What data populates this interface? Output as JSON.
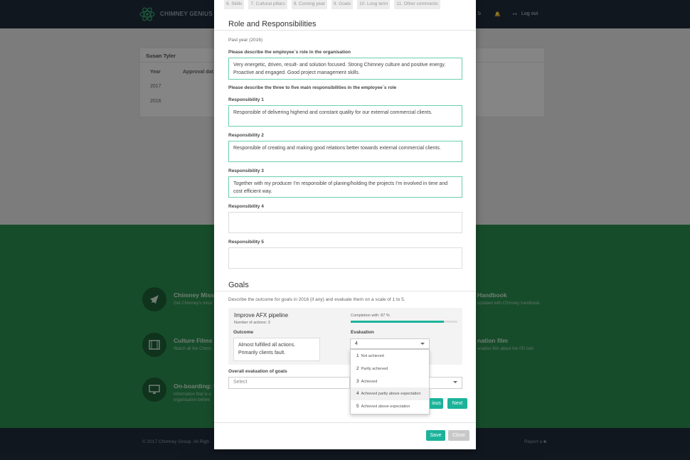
{
  "header": {
    "brand": "CHIMNEY GENIUS HU",
    "tab_fragment": "b",
    "logout": "Log out"
  },
  "card": {
    "employee": "Susan Tyler",
    "col_year": "Year",
    "col_approval": "Approval dat",
    "years": [
      "2017",
      "2016"
    ]
  },
  "features_left": [
    {
      "title": "Chimney Missi",
      "text": "Get Chimney's missi"
    },
    {
      "title": "Culture Films",
      "text": "Watch all the Chimn"
    },
    {
      "title": "On-boarding: t",
      "text": "Information that is u",
      "text2": "organisation before"
    }
  ],
  "features_right": [
    {
      "title": "Handbook",
      "text": "updated with Chimney handbook."
    },
    {
      "title": "nation film",
      "text": "anation film about the PD tool"
    }
  ],
  "footer": {
    "copyright": "© 2017 Chimney Group. All Righ",
    "report": "Report a"
  },
  "modal": {
    "steps": [
      "6. Skills",
      "7. Cultural pillars",
      "8. Coming year",
      "9. Goals",
      "10. Long term",
      "11. Other comments"
    ],
    "role_title": "Role and Responsibilities",
    "past_year": "Past year (2016)",
    "role_label": "Please describe the employee´s role in the organisation",
    "role_text": "Very energetic, driven, result- and solution focused. Strong Chimney culture and positive energy. Proactive and engaged. Good project management skills.",
    "resp_intro": "Please describe the three to five main responsibilities in the employee´s role",
    "responsibilities": [
      {
        "label": "Responsibility 1",
        "text": "Responsible of delivering highend and constant quality for our external commercial clients."
      },
      {
        "label": "Responsibility 2",
        "text": "Responsible of creating and making good relations better towards external commercial clients."
      },
      {
        "label": "Responsibility 3",
        "text": "Together with my producer I'm responsible of planing/holding the projects I'm involved in time and cost efficient way."
      },
      {
        "label": "Responsibility 4",
        "text": ""
      },
      {
        "label": "Responsibility 5",
        "text": ""
      }
    ],
    "goals_title": "Goals",
    "goals_intro": "Describe the outcome for goals in 2016 (if any) and evaluate them on a scale of 1 to 5.",
    "goal": {
      "title": "Improve AFX pipeline",
      "actions": "Number of actions: 3",
      "completion": "Completion with: 87 %",
      "completion_fraction": 0.87,
      "outcome_label": "Outcome",
      "outcome_text": "Almost fulfilled all actions. Primarily clients fault.",
      "evaluation_label": "Evaluation",
      "evaluation_value": "4"
    },
    "evaluation_options": [
      {
        "num": "1",
        "text": "Not achieved"
      },
      {
        "num": "2",
        "text": "Partly achieved"
      },
      {
        "num": "3",
        "text": "Achieved"
      },
      {
        "num": "4",
        "text": "Achieved partly above expectation"
      },
      {
        "num": "5",
        "text": "Achieved above expectation"
      }
    ],
    "overall_label": "Overall evaluation of goals",
    "overall_placeholder": "Select",
    "previous": "ious",
    "next": "Next",
    "save": "Save",
    "close": "Close"
  }
}
